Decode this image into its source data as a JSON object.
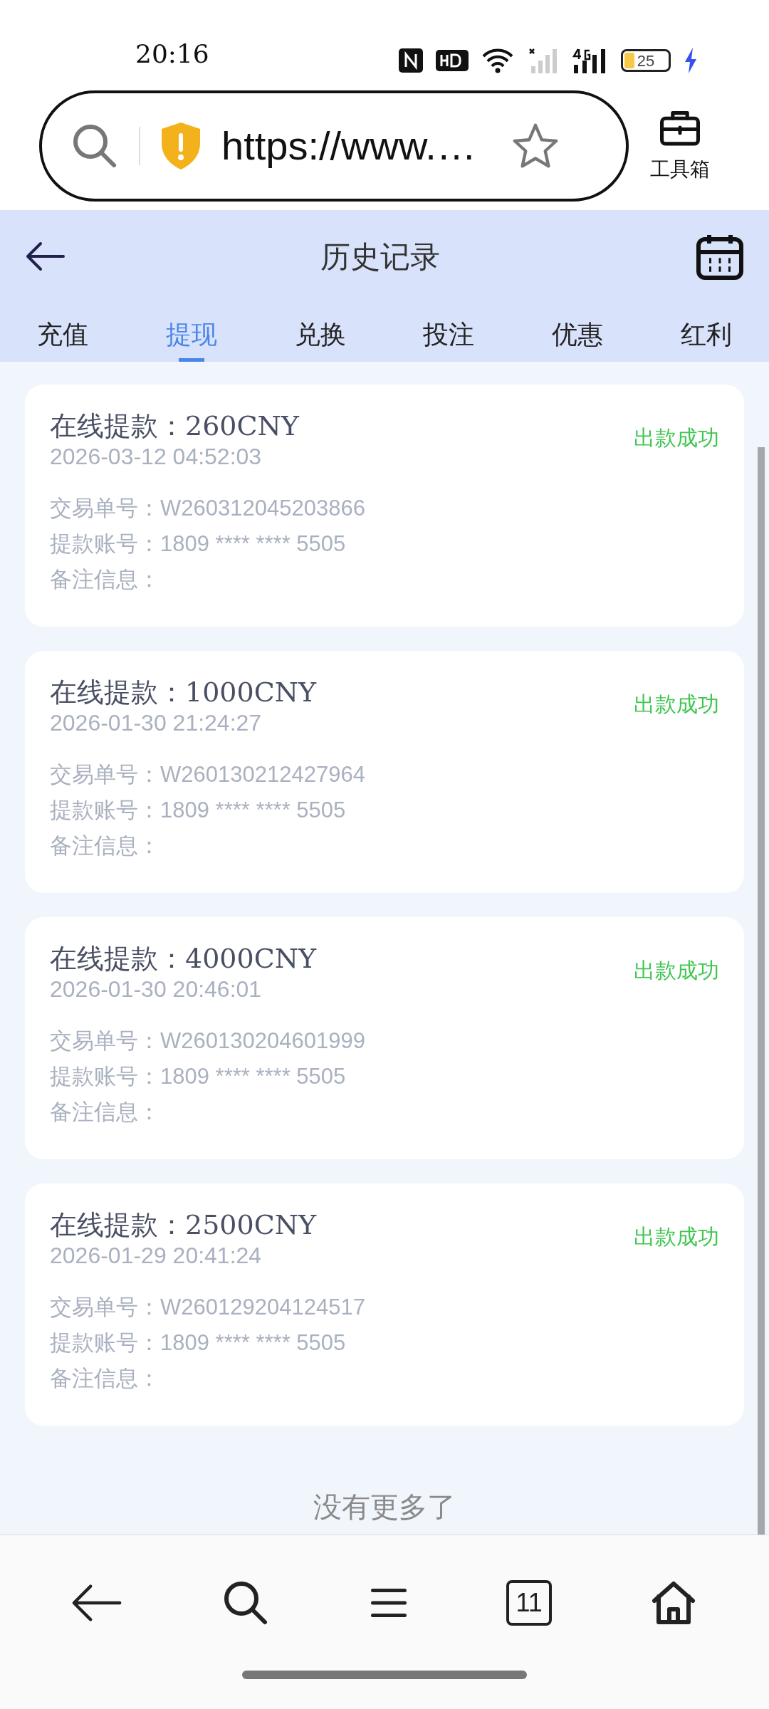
{
  "status_bar": {
    "time": "20:16",
    "battery": "25"
  },
  "browser": {
    "url": "https://www.…",
    "toolbox_label": "工具箱"
  },
  "header": {
    "title": "历史记录"
  },
  "tabs": [
    {
      "label": "充值",
      "selected": false
    },
    {
      "label": "提现",
      "selected": true
    },
    {
      "label": "兑换",
      "selected": false
    },
    {
      "label": "投注",
      "selected": false
    },
    {
      "label": "优惠",
      "selected": false
    },
    {
      "label": "红利",
      "selected": false
    }
  ],
  "records": [
    {
      "title": "在线提款：260CNY",
      "time": "2026-03-12 04:52:03",
      "status": "出款成功",
      "order": "交易单号：W260312045203866",
      "account": "提款账号：1809 **** **** 5505",
      "note": "备注信息："
    },
    {
      "title": "在线提款：1000CNY",
      "time": "2026-01-30 21:24:27",
      "status": "出款成功",
      "order": "交易单号：W260130212427964",
      "account": "提款账号：1809 **** **** 5505",
      "note": "备注信息："
    },
    {
      "title": "在线提款：4000CNY",
      "time": "2026-01-30 20:46:01",
      "status": "出款成功",
      "order": "交易单号：W260130204601999",
      "account": "提款账号：1809 **** **** 5505",
      "note": "备注信息："
    },
    {
      "title": "在线提款：2500CNY",
      "time": "2026-01-29 20:41:24",
      "status": "出款成功",
      "order": "交易单号：W260129204124517",
      "account": "提款账号：1809 **** **** 5505",
      "note": "备注信息："
    }
  ],
  "end_text": "没有更多了",
  "bottom_nav": {
    "tab_count": "11"
  }
}
